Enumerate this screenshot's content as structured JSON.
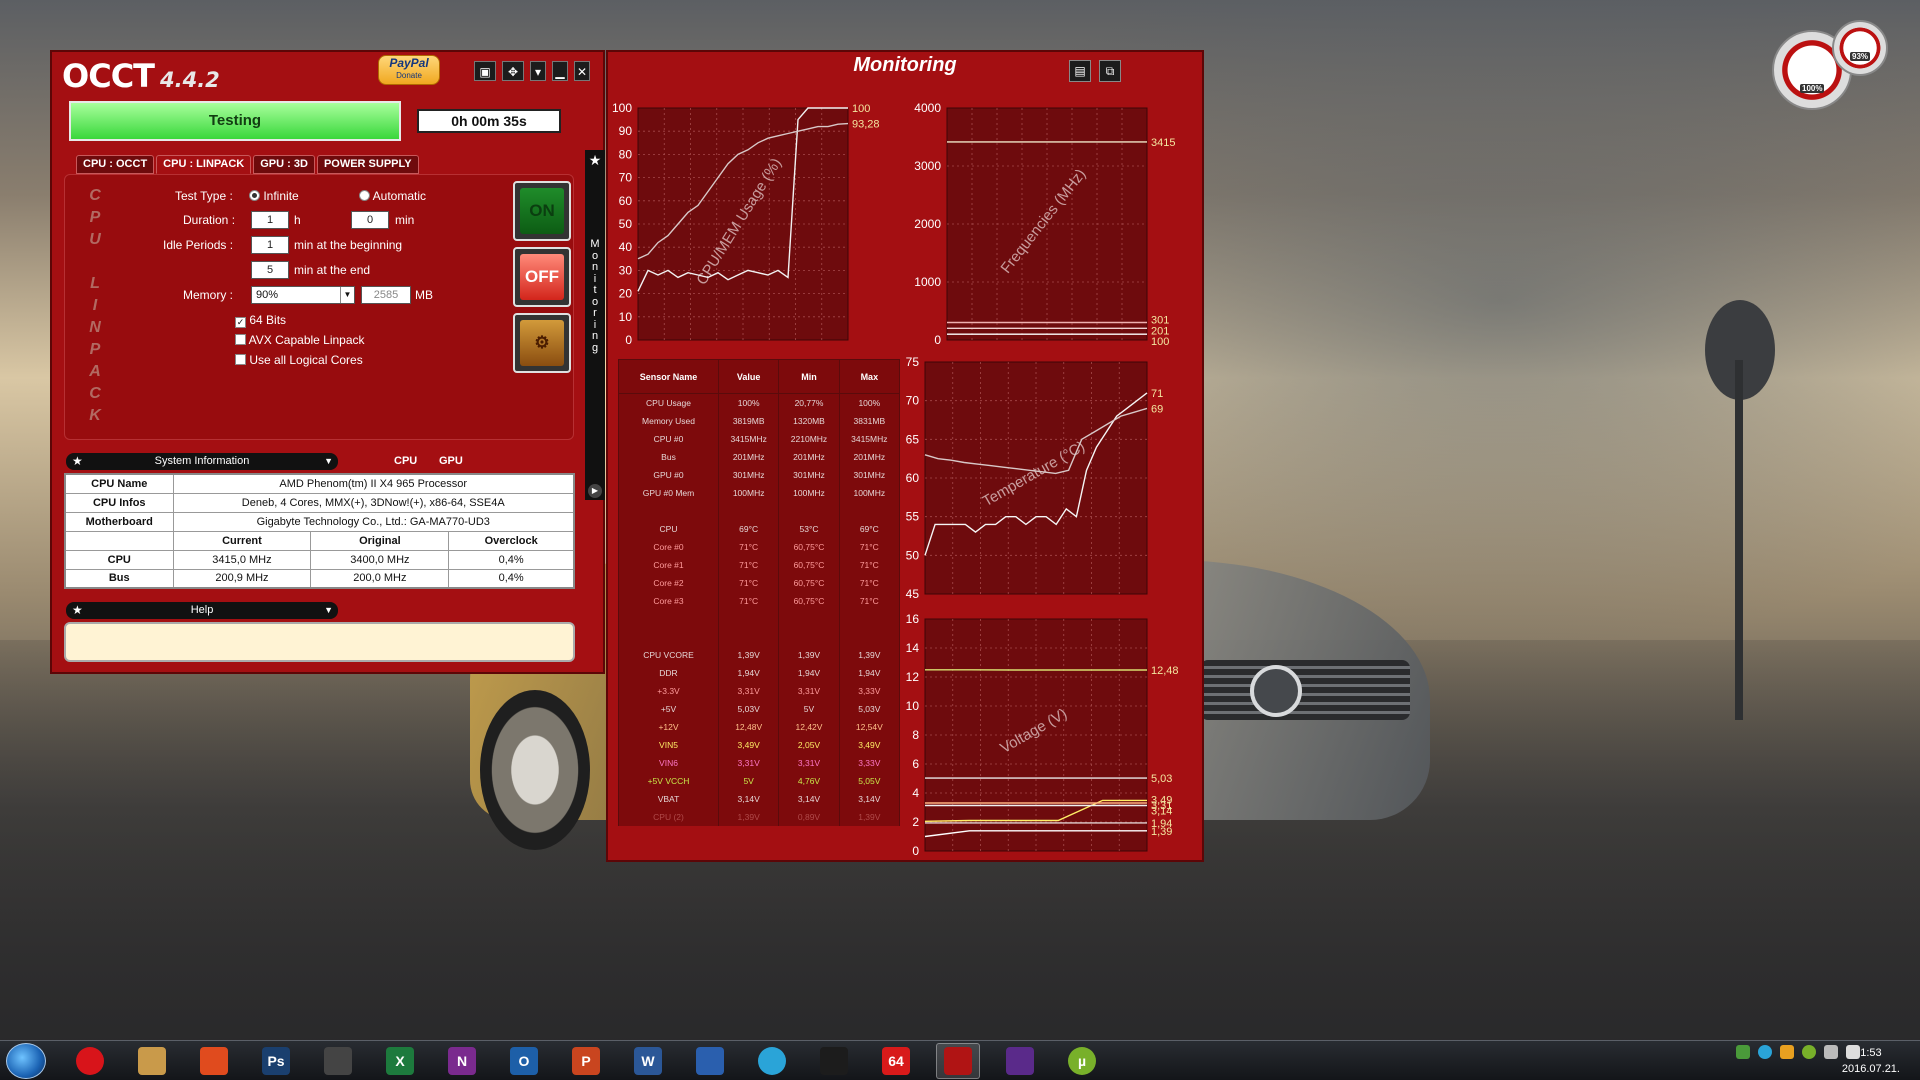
{
  "occt": {
    "logo": "OCCT",
    "version": "4.4.2",
    "paypal": "PayPal",
    "donate": "Donate",
    "status": "Testing",
    "timer": "0h 00m 35s",
    "tabs": [
      "CPU : OCCT",
      "CPU : LINPACK",
      "GPU : 3D",
      "POWER SUPPLY"
    ],
    "side_label": [
      "C",
      "P",
      "U",
      "",
      "L",
      "I",
      "N",
      "P",
      "A",
      "C",
      "K"
    ],
    "test_type_label": "Test Type :",
    "infinite": "Infinite",
    "automatic": "Automatic",
    "duration_label": "Duration :",
    "duration_h": "1",
    "h_unit": "h",
    "duration_min": "0",
    "min_unit": "min",
    "idle_label": "Idle Periods :",
    "idle_begin": "1",
    "idle_begin_text": "min at the beginning",
    "idle_end": "5",
    "idle_end_text": "min at the end",
    "memory_label": "Memory :",
    "memory_pct": "90%",
    "memory_mb": "2585",
    "mb_unit": "MB",
    "chk_64": "64 Bits",
    "chk_avx": "AVX Capable Linpack",
    "chk_logical": "Use all Logical Cores",
    "btn_on": "ON",
    "btn_off": "OFF",
    "sysinfo_title": "System Information",
    "tab_cpu": "CPU",
    "tab_gpu": "GPU",
    "sys_rows": [
      {
        "k": "CPU Name",
        "v": "AMD Phenom(tm) II X4 965 Processor"
      },
      {
        "k": "CPU Infos",
        "v": "Deneb, 4 Cores, MMX(+), 3DNow!(+), x86-64, SSE4A"
      },
      {
        "k": "Motherboard",
        "v": "Gigabyte Technology Co., Ltd.: GA-MA770-UD3"
      }
    ],
    "clock_headers": [
      "Current",
      "Original",
      "Overclock"
    ],
    "clock_rows": [
      {
        "k": "CPU",
        "current": "3415,0 MHz",
        "original": "3400,0 MHz",
        "oc": "0,4%"
      },
      {
        "k": "Bus",
        "current": "200,9 MHz",
        "original": "200,0 MHz",
        "oc": "0,4%"
      }
    ],
    "help_title": "Help",
    "monitoring_strip": "Monitoring"
  },
  "monitoring": {
    "title": "Monitoring",
    "sensor_headers": [
      "Sensor Name",
      "Value",
      "Min",
      "Max"
    ],
    "sensors": [
      [
        "CPU Usage",
        "100%",
        "20,77%",
        "100%"
      ],
      [
        "Memory Used",
        "3819MB",
        "1320MB",
        "3831MB"
      ],
      [
        "CPU #0",
        "3415MHz",
        "2210MHz",
        "3415MHz"
      ],
      [
        "Bus",
        "201MHz",
        "201MHz",
        "201MHz"
      ],
      [
        "GPU #0",
        "301MHz",
        "301MHz",
        "301MHz"
      ],
      [
        "GPU #0 Mem",
        "100MHz",
        "100MHz",
        "100MHz"
      ],
      [
        "",
        "",
        "",
        ""
      ],
      [
        "CPU",
        "69°C",
        "53°C",
        "69°C"
      ],
      [
        "Core #0",
        "71°C",
        "60,75°C",
        "71°C"
      ],
      [
        "Core #1",
        "71°C",
        "60,75°C",
        "71°C"
      ],
      [
        "Core #2",
        "71°C",
        "60,75°C",
        "71°C"
      ],
      [
        "Core #3",
        "71°C",
        "60,75°C",
        "71°C"
      ],
      [
        "",
        "",
        "",
        ""
      ],
      [
        "",
        "",
        "",
        ""
      ],
      [
        "CPU VCORE",
        "1,39V",
        "1,39V",
        "1,39V"
      ],
      [
        "DDR",
        "1,94V",
        "1,94V",
        "1,94V"
      ],
      [
        "+3.3V",
        "3,31V",
        "3,31V",
        "3,33V"
      ],
      [
        "+5V",
        "5,03V",
        "5V",
        "5,03V"
      ],
      [
        "+12V",
        "12,48V",
        "12,42V",
        "12,54V"
      ],
      [
        "VIN5",
        "3,49V",
        "2,05V",
        "3,49V"
      ],
      [
        "VIN6",
        "3,31V",
        "3,31V",
        "3,33V"
      ],
      [
        "+5V VCCH",
        "5V",
        "4,76V",
        "5,05V"
      ],
      [
        "VBAT",
        "3,14V",
        "3,14V",
        "3,14V"
      ],
      [
        "CPU (2)",
        "1,39V",
        "0,89V",
        "1,39V"
      ]
    ],
    "sensor_colors": [
      "#e5d6d6",
      "#e5d6d6",
      "#e5d6d6",
      "#e5d6d6",
      "#e5d6d6",
      "#e5d6d6",
      "#e5d6d6",
      "#e5d6d6",
      "#ff9b9b",
      "#ff9b9b",
      "#ff9b9b",
      "#ff9b9b",
      "#e5d6d6",
      "#e5d6d6",
      "#e5d6d6",
      "#e5d6d6",
      "#ff9b9b",
      "#e5d6d6",
      "#ffc08a",
      "#ffee66",
      "#ff77c8",
      "#c8e84a",
      "#e5d6d6",
      "#b04a4a"
    ]
  },
  "chart_data": [
    {
      "type": "line",
      "title": "CPU/MEM Usage (%)",
      "ylim": [
        0,
        100
      ],
      "yticks": [
        "100",
        "90",
        "80",
        "70",
        "60",
        "50",
        "40",
        "30",
        "20",
        "10",
        "0"
      ],
      "series": [
        {
          "name": "CPU Usage",
          "color": "#f2f2f2",
          "values": [
            21,
            30,
            28,
            30,
            27,
            29,
            28,
            27,
            29,
            26,
            28,
            30,
            29,
            28,
            30,
            27,
            95,
            100,
            100,
            100,
            100,
            100
          ]
        },
        {
          "name": "Memory Used",
          "color": "#d8c8c8",
          "values": [
            35,
            37,
            42,
            45,
            50,
            55,
            58,
            64,
            70,
            76,
            80,
            82,
            85,
            87,
            88,
            89,
            90,
            91,
            92,
            92,
            93,
            93.28
          ]
        }
      ],
      "end_labels": [
        "100",
        "93,28"
      ]
    },
    {
      "type": "line",
      "title": "Frequencies (MHz)",
      "ylim": [
        0,
        4000
      ],
      "yticks": [
        "4000",
        "3000",
        "2000",
        "1000",
        "0"
      ],
      "series": [
        {
          "name": "CPU #0",
          "color": "#f0e8c8",
          "values": [
            3415,
            3415,
            3415,
            3415,
            3415,
            3415
          ]
        },
        {
          "name": "GPU #0",
          "color": "#f0b0b0",
          "values": [
            301,
            301,
            301,
            301,
            301,
            301
          ]
        },
        {
          "name": "Bus",
          "color": "#f0d0d0",
          "values": [
            201,
            201,
            201,
            201,
            201,
            201
          ]
        },
        {
          "name": "GPU #0 Mem",
          "color": "#ffffff",
          "values": [
            100,
            100,
            100,
            100,
            100,
            100
          ]
        }
      ],
      "end_labels": [
        "3415",
        "301",
        "201",
        "100"
      ]
    },
    {
      "type": "line",
      "title": "Temperature (°C)",
      "ylim": [
        45,
        75
      ],
      "yticks": [
        "75",
        "70",
        "65",
        "60",
        "55",
        "50",
        "45"
      ],
      "series": [
        {
          "name": "Core #0",
          "color": "#f5f5f5",
          "values": [
            50,
            54,
            54,
            54,
            54,
            53,
            54,
            54,
            55,
            55,
            54,
            55,
            55,
            54,
            56,
            55,
            61,
            64,
            66,
            68,
            69,
            70,
            71
          ]
        },
        {
          "name": "CPU",
          "color": "#d8c8c8",
          "values": [
            63,
            62.5,
            62.3,
            62,
            61.8,
            61.6,
            61.4,
            61.2,
            61,
            60.8,
            60.6,
            61,
            65,
            66,
            67,
            68,
            68.5,
            69
          ]
        }
      ],
      "end_labels": [
        "71",
        "69"
      ]
    },
    {
      "type": "line",
      "title": "Voltage (V)",
      "ylim": [
        0,
        16
      ],
      "yticks": [
        "16",
        "14",
        "12",
        "10",
        "8",
        "6",
        "4",
        "2",
        "0"
      ],
      "series": [
        {
          "name": "+12V",
          "color": "#d8e070",
          "values": [
            12.5,
            12.5,
            12.48,
            12.48,
            12.48,
            12.48
          ]
        },
        {
          "name": "+5V",
          "color": "#e8e8e8",
          "values": [
            5.03,
            5.03,
            5.03,
            5.03,
            5.03,
            5.03
          ]
        },
        {
          "name": "VIN5",
          "color": "#ffee66",
          "values": [
            2.05,
            2.1,
            2.1,
            2.1,
            3.49,
            3.49
          ]
        },
        {
          "name": "+3.3V",
          "color": "#ffb080",
          "values": [
            3.31,
            3.31,
            3.31,
            3.31,
            3.31,
            3.31
          ]
        },
        {
          "name": "VBAT",
          "color": "#f0f0f0",
          "values": [
            3.14,
            3.14,
            3.14,
            3.14,
            3.14,
            3.14
          ]
        },
        {
          "name": "DDR",
          "color": "#e0d0d0",
          "values": [
            1.94,
            1.94,
            1.94,
            1.94,
            1.94,
            1.94
          ]
        },
        {
          "name": "CPU VCORE",
          "color": "#ffffff",
          "values": [
            1.0,
            1.39,
            1.39,
            1.39,
            1.39,
            1.39
          ]
        }
      ],
      "end_labels": [
        "12,48",
        "5,03",
        "3,49",
        "3,31",
        "3,14",
        "1,94",
        "1,39"
      ]
    }
  ],
  "taskbar": {
    "apps": [
      "Opera",
      "Pencil",
      "CCleaner",
      "Ps",
      "Film",
      "Excel",
      "OneNote",
      "Outlook",
      "PowerPoint",
      "Word",
      "Save",
      "Skype",
      "Fan",
      "64",
      "OCCT",
      "CPU",
      "uTorrent"
    ],
    "app_text": [
      "",
      "",
      "",
      "Ps",
      "",
      "X",
      "N",
      "O",
      "P",
      "W",
      "",
      "",
      "",
      "64",
      "",
      "",
      "µ"
    ],
    "app_colors": [
      "#d8141a",
      "#c99a4a",
      "#e04b1e",
      "#1a3f6e",
      "#444",
      "#1d7a3d",
      "#7a2a8e",
      "#1d5fa8",
      "#c9451f",
      "#2b5797",
      "#2a5fae",
      "#2aa4d8",
      "#1c1c1c",
      "#d81a1a",
      "#b01414",
      "#5a2a8a",
      "#78b02a"
    ],
    "time": "1:53",
    "date": "2016.07.21."
  },
  "gadget": {
    "cpu_pct": "100%",
    "mem_pct": "93%"
  }
}
